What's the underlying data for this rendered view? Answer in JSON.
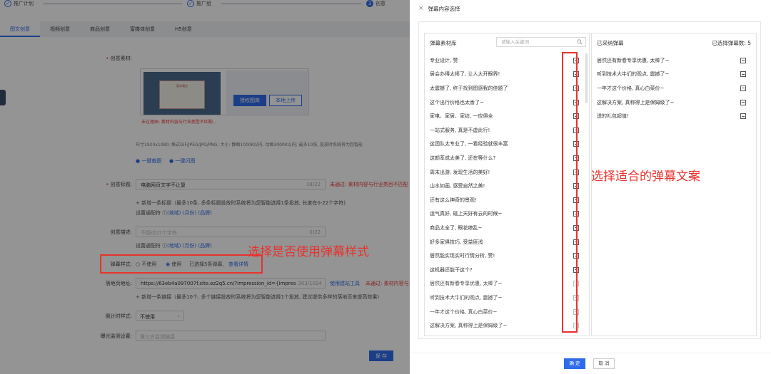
{
  "steps": {
    "s1": "推广计划",
    "s2": "推广组",
    "s3": "创意",
    "s3_num": "3"
  },
  "tabs": [
    "图文创意",
    "视频创意",
    "商品创意",
    "富媒体创意",
    "H5创意"
  ],
  "form": {
    "material_label": "创意素材:",
    "thumb_title": "暂未通过",
    "auth_button": "授权图库",
    "upload_button": "本地上传",
    "audit_fail": "未过理由: 素材内容与行业类型不匹配...",
    "size_hint": "尺寸1920x1080; 格式GIF/JPEG/JPG/PNG; 大小: 静图1000K以内, 动图3000K以内; 最多10张, 投放时系统将为您智能",
    "one_click_crop": "一键裁图",
    "one_click_flash": "一键闪图",
    "title_label": "创意标题:",
    "title_value": "电脑网页文字不让复",
    "title_count": "18/22",
    "title_fail": "未通过: 素材内容与行业类目不匹配",
    "add_title": "+ 新增一条标题（最多10条, 多条标题投放时系统将为您智能选择1条投放, 长度在0-22个字符)",
    "wildcard_label": "设置通配符 ⓘ",
    "wildcard_links": "(地域) (月份) (品牌)",
    "desc_label": "创意描述:",
    "desc_placeholder": "不超过22个字符",
    "desc_count": "0/22",
    "wildcard_label2": "设置通配符 ⓘ",
    "wildcard_links2": "(地域) (月份) (品牌)",
    "danmu_label": "弹幕样式:",
    "opt_no": "不使用",
    "opt_yes": "使用",
    "danmu_selected": "已选择5条弹幕,",
    "danmu_detail": "查看详情",
    "landing_label": "落地页地址:",
    "landing_value": "https://63eb4a097007f.site.ez2q5.cn/?impression_id={impression",
    "landing_count": "203/1024",
    "landing_tool": "使用建站工具",
    "landing_fail": "未通过: 素材内容与",
    "add_link": "+ 新增一条链接（最多10个, 多个链接投放时系统将为您智能选择1个投放, 建议提供多样的落地页来提高效果)",
    "countdown_label": "倒计时样式:",
    "countdown_value": "不使用",
    "exposure_label": "曝光监测设置:",
    "exposure_placeholder": "第三方监测链接",
    "save_button": "保 存"
  },
  "annotations": {
    "left_note": "选择是否使用弹幕样式",
    "right_note": "选择适合的弹幕文案"
  },
  "modal": {
    "title": "弹幕内容选择",
    "library_title": "弹幕素材库",
    "search_placeholder": "请输入关键词",
    "selected_title": "已采纳弹幕",
    "selected_count": "已选择弹幕数: 5",
    "library_items": [
      "专业设计, 赞",
      "居会办得太棒了, 让人大开眼界!",
      "太震撼了, 终于找到图感我的佳题了",
      "这个出行价格也太香了~",
      "家电、家居、家纺, 一应俱全",
      "一站式服务, 真是不虚此行!",
      "这团队太专业了, 一看经验就很丰富",
      "这颜萃成太美了, 还在等什么?",
      "周末出游, 发现生活的美好!",
      "山水如画, 感受自然之美!",
      "还有这么神奇的景观!",
      "运气真好, 碰上天好有云的时候~",
      "商品太全了, 眼花缭乱~",
      "好多家俱技巧, 受益匪浅",
      "居然能实现实时行情分析, 赞!",
      "这机器还能干这个?",
      "居然还有新春专享优惠, 太棒了~",
      "听到技术大牛们的观点, 震撼了~",
      "一年才这个价格, 真心白菜价~",
      "这解决方案, 真称得上是保姆级了~"
    ],
    "selected_items": [
      "居然还有新春专享优惠, 太棒了~",
      "听到技术大牛们的观点, 震撼了~",
      "一年才这个价格, 真心白菜价~",
      "这解决方案, 真称得上是保姆级了~",
      "送的礼包超值!"
    ],
    "confirm": "确 定",
    "cancel": "取 消"
  }
}
